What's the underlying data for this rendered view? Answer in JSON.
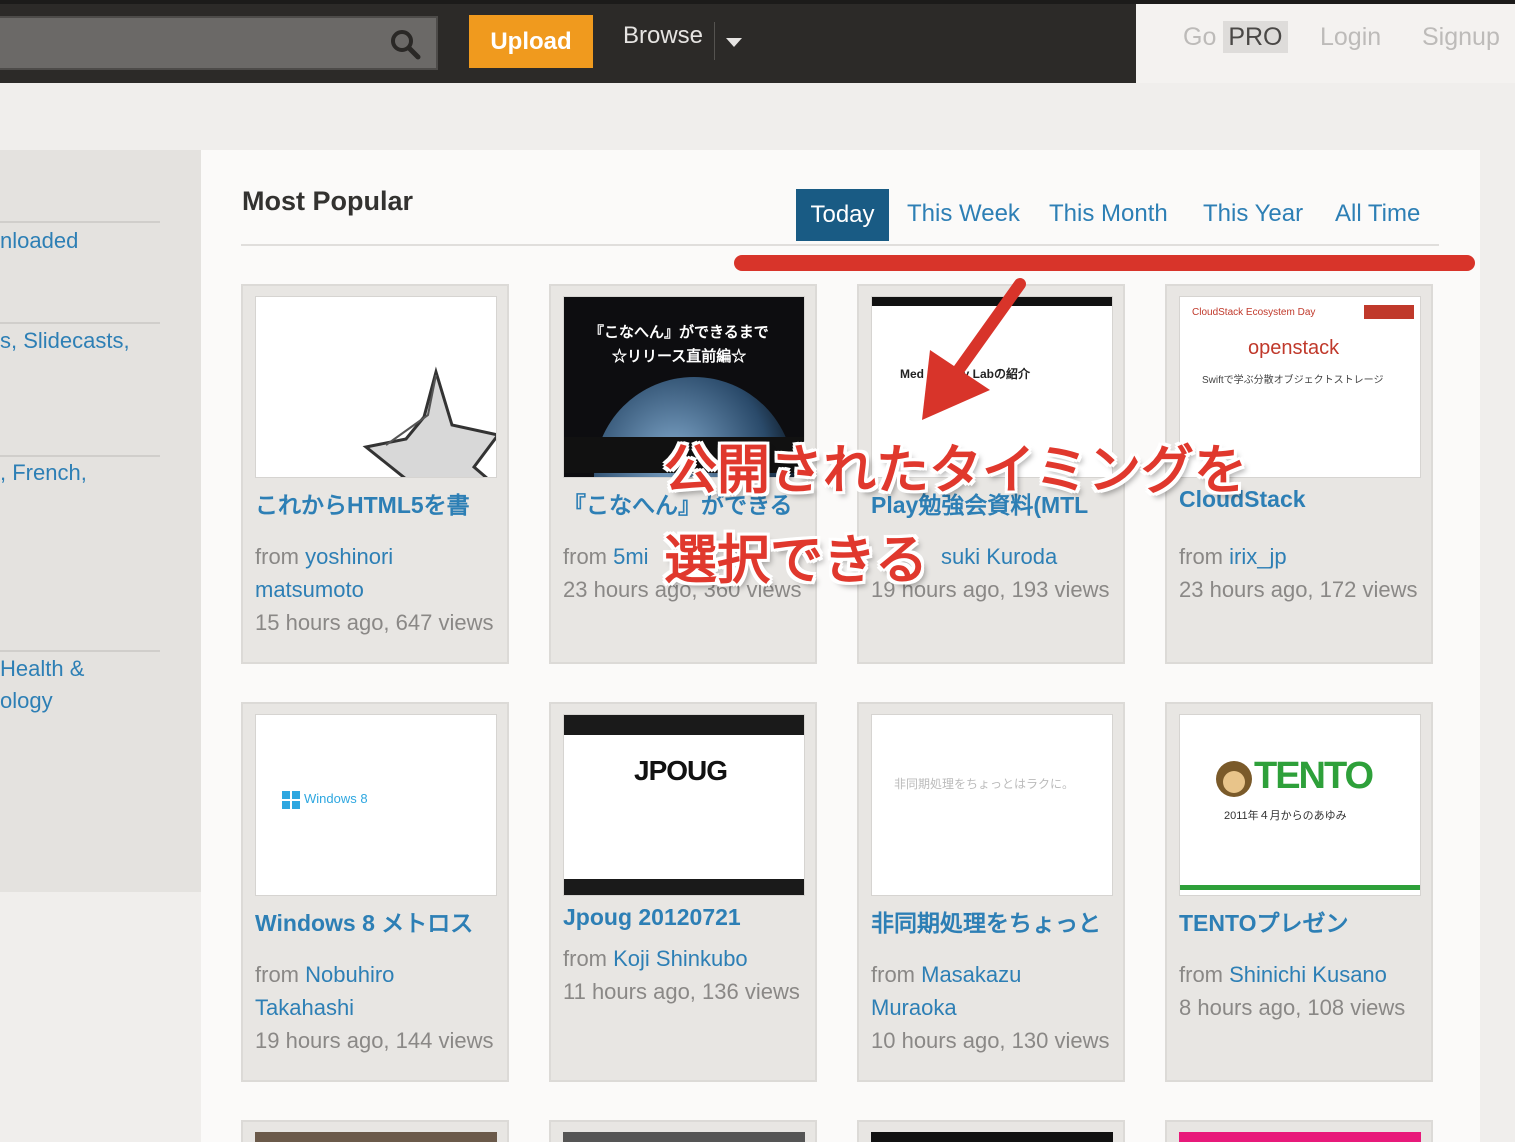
{
  "header": {
    "upload_label": "Upload",
    "browse_label": "Browse",
    "go_label": "Go",
    "pro_label": "PRO",
    "login_label": "Login",
    "signup_label": "Signup"
  },
  "sidebar": {
    "items": [
      "nloaded",
      "s, Slidecasts,",
      ", French,",
      "Health &",
      "ology"
    ]
  },
  "main": {
    "title": "Most Popular",
    "tabs": [
      "Today",
      "This Week",
      "This Month",
      "This Year",
      "All Time"
    ],
    "active_tab": "Today"
  },
  "cards": [
    {
      "title": "これからHTML5を書",
      "from": "from",
      "author": "yoshinori matsumoto",
      "meta": "15 hours ago, 647 views"
    },
    {
      "title": "『こなへん』ができる",
      "from": "from",
      "author": "5mi",
      "meta": "23 hours ago, 360 views",
      "thumb_line1": "『こなへん』ができるまで",
      "thumb_line2": "☆リリース直前編☆"
    },
    {
      "title": "Play勉強会資料(MTL",
      "from": "",
      "author": "suki Kuroda",
      "meta": "19 hours ago, 193 views",
      "thumb_text": "Med    ology Labの紹介"
    },
    {
      "title": "CloudStack",
      "from": "from",
      "author": "irix_jp",
      "meta": "23 hours ago, 172 views",
      "thumb_header": "CloudStack Ecosystem Day",
      "thumb_brand": "openstack",
      "thumb_sub": "Swiftで学ぶ分散オブジェクトストレージ"
    },
    {
      "title": "Windows 8 メトロス",
      "from": "from",
      "author": "Nobuhiro Takahashi",
      "meta": "19 hours ago, 144 views",
      "thumb_text": "Windows 8"
    },
    {
      "title": "Jpoug 20120721",
      "from": "from",
      "author": "Koji Shinkubo",
      "meta": "11 hours ago, 136 views",
      "thumb_text": "JPOUG"
    },
    {
      "title": "非同期処理をちょっと",
      "from": "from",
      "author": "Masakazu Muraoka",
      "meta": "10 hours ago, 130 views",
      "thumb_text": "非同期処理をちょっとはラクに。"
    },
    {
      "title": "TENTOプレゼン",
      "from": "from",
      "author": "Shinichi Kusano",
      "meta": "8 hours ago, 108 views",
      "thumb_brand": "TENTO",
      "thumb_sub": "2011年４月からのあゆみ"
    }
  ],
  "annotation": {
    "line1": "公開されたタイミングを",
    "line2": "選択できる",
    "color": "#e0382d"
  },
  "colors": {
    "accent_orange": "#f09a1e",
    "link_blue": "#2d7fb5",
    "active_tab_bg": "#195b84",
    "topbar_bg": "#2c2a28"
  }
}
